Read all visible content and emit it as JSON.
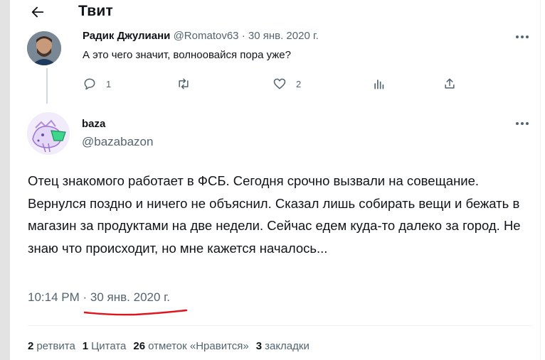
{
  "header": {
    "title": "Твит",
    "back_icon": "arrow-left-icon"
  },
  "parent_tweet": {
    "author_name": "Радик Джулиани",
    "handle": "@Romatov63",
    "separator": "·",
    "date": "30 янв. 2020 г.",
    "text": "А это чего значит, волноовайся пора уже?",
    "actions": {
      "replies": "1",
      "retweets": "",
      "likes": "2",
      "views": "",
      "share": ""
    }
  },
  "main_tweet": {
    "author_name": "baza",
    "handle": "@bazabazon",
    "text": "Отец знакомого работает в ФСБ. Сегодня срочно вызвали на совещание. Вернулся поздно и ничего не объяснил. Сказал лишь собирать вещи и бежать в магазин за продуктами на две недели. Сейчас едем куда-то далеко за город. Не знаю что происходит, но мне кажется началось...",
    "time": "10:14 PM",
    "separator": "·",
    "date": "30 янв. 2020 г.",
    "highlight_color": "#e0141c"
  },
  "stats": [
    {
      "count": "2",
      "label": "ретвита"
    },
    {
      "count": "1",
      "label": "Цитата"
    },
    {
      "count": "26",
      "label": "отметок «Нравится»"
    },
    {
      "count": "3",
      "label": "закладки"
    }
  ],
  "colors": {
    "text": "#0f1419",
    "secondary": "#536471",
    "divider": "#eff3f4",
    "rail": "#e3e3e3"
  }
}
